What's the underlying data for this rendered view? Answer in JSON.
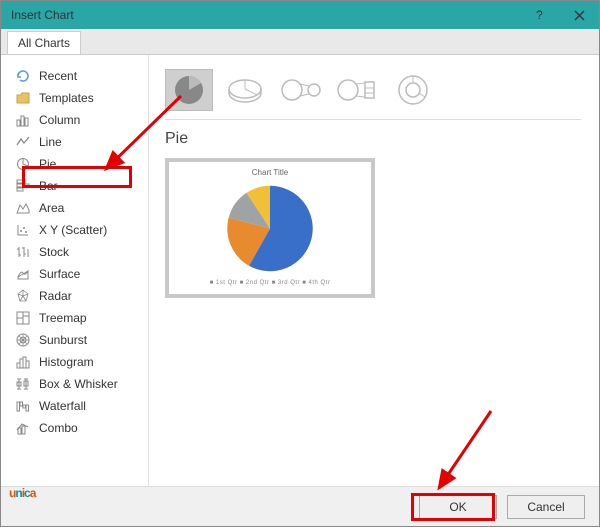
{
  "window": {
    "title": "Insert Chart"
  },
  "tabs": {
    "all": "All Charts"
  },
  "sidebar": {
    "items": [
      {
        "label": "Recent"
      },
      {
        "label": "Templates"
      },
      {
        "label": "Column"
      },
      {
        "label": "Line"
      },
      {
        "label": "Pie"
      },
      {
        "label": "Bar"
      },
      {
        "label": "Area"
      },
      {
        "label": "X Y (Scatter)"
      },
      {
        "label": "Stock"
      },
      {
        "label": "Surface"
      },
      {
        "label": "Radar"
      },
      {
        "label": "Treemap"
      },
      {
        "label": "Sunburst"
      },
      {
        "label": "Histogram"
      },
      {
        "label": "Box & Whisker"
      },
      {
        "label": "Waterfall"
      },
      {
        "label": "Combo"
      }
    ]
  },
  "main": {
    "section_title": "Pie",
    "preview_title": "Chart Title",
    "preview_legend": "■ 1st Qtr  ■ 2nd Qtr  ■ 3rd Qtr  ■ 4th Qtr"
  },
  "footer": {
    "ok": "OK",
    "cancel": "Cancel"
  },
  "chart_data": {
    "type": "pie",
    "title": "Chart Title",
    "categories": [
      "1st Qtr",
      "2nd Qtr",
      "3rd Qtr",
      "4th Qtr"
    ],
    "values": [
      58,
      23,
      10,
      9
    ],
    "colors": [
      "#3a6fc9",
      "#e88b2e",
      "#9fa3a6",
      "#f2c037"
    ]
  },
  "watermark": "unica"
}
